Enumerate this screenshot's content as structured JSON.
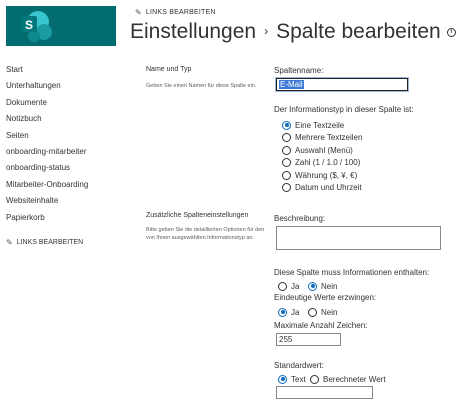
{
  "header": {
    "edit_links": "LINKS BEARBEITEN",
    "title_part1": "Einstellungen",
    "separator": "›",
    "title_part2": "Spalte bearbeiten",
    "brand_color": "#036c70",
    "logo_letter": "S"
  },
  "nav": {
    "items": [
      "Start",
      "Unterhaltungen",
      "Dokumente",
      "Notizbuch",
      "Seiten",
      "onboarding-mitarbeiter",
      "onboarding-status",
      "Mitarbeiter-Onboarding",
      "Websiteinhalte",
      "Papierkorb"
    ],
    "edit_links": "LINKS BEARBEITEN"
  },
  "section_name_type": {
    "title": "Name und Typ",
    "description": "Geben Sie einen Namen für diese Spalte ein."
  },
  "section_additional": {
    "title": "Zusätzliche Spalteneinstellungen",
    "description": "Bitte geben Sie die detaillierten Optionen für den von Ihnen ausgewählten Informationstyp an."
  },
  "form": {
    "column_name_label": "Spaltenname:",
    "column_name_value": "E-Mail",
    "info_type_label": "Der Informationstyp in dieser Spalte ist:",
    "info_types": [
      {
        "label": "Eine Textzeile",
        "selected": true
      },
      {
        "label": "Mehrere Textzeilen",
        "selected": false
      },
      {
        "label": "Auswahl (Menü)",
        "selected": false
      },
      {
        "label": "Zahl (1 / 1.0 / 100)",
        "selected": false
      },
      {
        "label": "Währung ($, ¥, €)",
        "selected": false
      },
      {
        "label": "Datum und Uhrzeit",
        "selected": false
      }
    ],
    "description_label": "Beschreibung:",
    "description_value": "",
    "required_label": "Diese Spalte muss Informationen enthalten:",
    "required_yes": "Ja",
    "required_no": "Nein",
    "unique_label": "Eindeutige Werte erzwingen:",
    "unique_yes": "Ja",
    "unique_no": "Nein",
    "max_chars_label": "Maximale Anzahl Zeichen:",
    "max_chars_value": "255",
    "default_label": "Standardwert:",
    "default_text": "Text",
    "default_calc": "Berechneter Wert",
    "default_value": "",
    "accent_color": "#0f6cbd"
  }
}
